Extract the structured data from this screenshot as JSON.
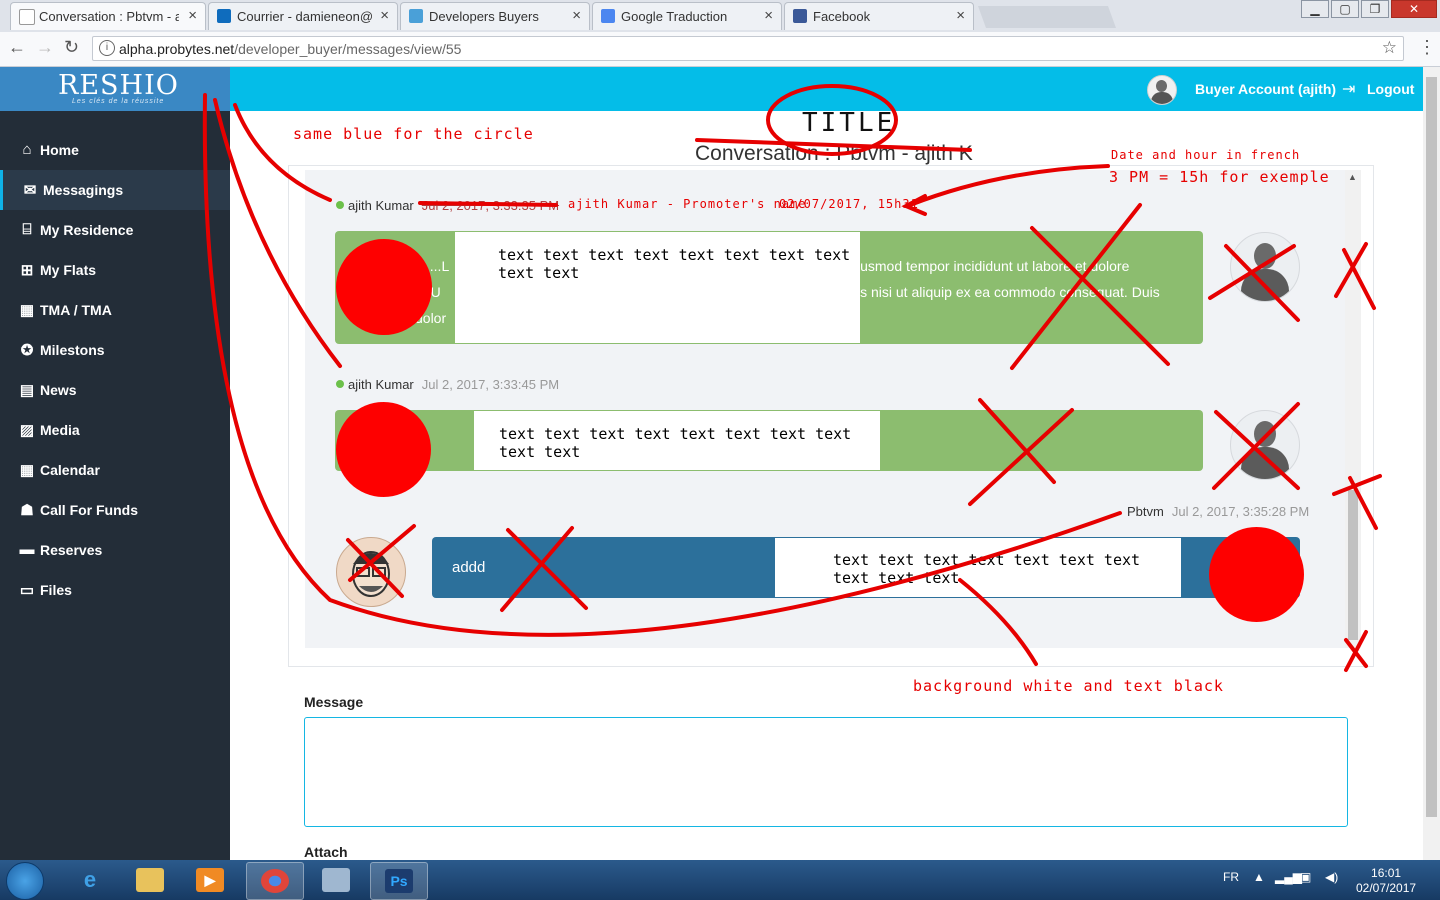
{
  "browser": {
    "tabs": [
      {
        "label": "Conversation : Pbtvm - a",
        "icon_color": "#ffffff"
      },
      {
        "label": "Courrier - damieneon@h",
        "icon_color": "#0f6cbd"
      },
      {
        "label": "Developers Buyers",
        "icon_color": "#4aa0d8"
      },
      {
        "label": "Google Traduction",
        "icon_color": "#4b86f0"
      },
      {
        "label": "Facebook",
        "icon_color": "#3b5998"
      }
    ],
    "url_host": "alpha.probytes.net",
    "url_path": "/developer_buyer/messages/view/55"
  },
  "brand": {
    "logo": "RESHIO",
    "tagline": "Les clés de la réussite"
  },
  "sidebar": {
    "items": [
      {
        "label": "Home",
        "icon": "home-icon",
        "glyph": "⌂"
      },
      {
        "label": "Messagings",
        "icon": "envelope-icon",
        "glyph": "✉"
      },
      {
        "label": "My Residence",
        "icon": "bank-icon",
        "glyph": "⌸"
      },
      {
        "label": "My Flats",
        "icon": "grid-icon",
        "glyph": "⊞"
      },
      {
        "label": "TMA / TMA",
        "icon": "building-question-icon",
        "glyph": "▦"
      },
      {
        "label": "Milestons",
        "icon": "milestone-icon",
        "glyph": "✪"
      },
      {
        "label": "News",
        "icon": "newspaper-icon",
        "glyph": "▤"
      },
      {
        "label": "Media",
        "icon": "picture-icon",
        "glyph": "▨"
      },
      {
        "label": "Calendar",
        "icon": "calendar-icon",
        "glyph": "▦"
      },
      {
        "label": "Call For Funds",
        "icon": "users-icon",
        "glyph": "☗"
      },
      {
        "label": "Reserves",
        "icon": "card-icon",
        "glyph": "▬"
      },
      {
        "label": "Files",
        "icon": "folder-open-icon",
        "glyph": "▭"
      }
    ],
    "active_index": 1
  },
  "topbar": {
    "account": "Buyer Account (ajith)",
    "logout": "Logout"
  },
  "conversation": {
    "title": "Conversation : Pbtvm - ajith K",
    "messages": [
      {
        "author": "ajith Kumar",
        "date": "Jul 2, 2017, 3:33:35 PM",
        "side": "left",
        "text_visible_left": "y ....L\na. U\ndolor",
        "text_visible_right": "iusmod tempor incididunt ut labore et dolore\nis nisi ut aliquip ex ea commodo consequat. Duis"
      },
      {
        "author": "ajith Kumar",
        "date": "Jul 2, 2017, 3:33:45 PM",
        "side": "left"
      },
      {
        "author": "Pbtvm",
        "date": "Jul 2, 2017, 3:35:28 PM",
        "side": "right",
        "text": "addd"
      }
    ]
  },
  "annotations": {
    "title_mock": "TITLE",
    "same_blue": "same blue for the circle",
    "date_hint_1": "Date and hour in french",
    "date_hint_2": "3 PM = 15h for exemple",
    "promoter": "ajith Kumar - Promoter's name",
    "french_date": "02/07/2017, 15h31",
    "placeholder_text": "text text text text text text text text text text",
    "bg_hint": "background white and text black",
    "color": "#fe0000"
  },
  "form": {
    "message_label": "Message",
    "attach_label": "Attach"
  },
  "taskbar": {
    "lang": "FR",
    "time": "16:01",
    "date": "02/07/2017"
  }
}
